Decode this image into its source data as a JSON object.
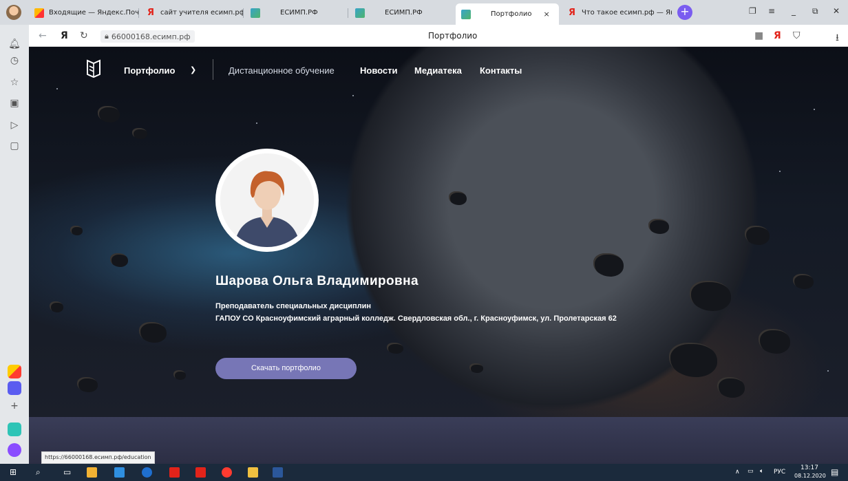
{
  "browser": {
    "tabs": [
      {
        "label": "Входящие — Яндекс.Почт",
        "icon": "mail-icon",
        "active": false
      },
      {
        "label": "сайт учителя есимп.рф —",
        "icon": "yandex-icon",
        "active": false
      },
      {
        "label": "ЕСИМП.РФ",
        "icon": "esimp-icon",
        "active": false
      },
      {
        "label": "ЕСИМП.РФ",
        "icon": "esimp-icon",
        "active": false
      },
      {
        "label": "Портфолио",
        "icon": "esimp-icon",
        "active": true
      },
      {
        "label": "Что такое есимп.рф — Ян",
        "icon": "yandex-icon",
        "active": false
      }
    ],
    "close_symbol": "×",
    "new_tab_symbol": "+",
    "address": "66000168.есимп.рф",
    "page_title": "Портфолио",
    "yandex_letter": "Я",
    "status_url": "https://66000168.есимп.рф/education"
  },
  "site": {
    "nav": {
      "portfolio": "Портфолио",
      "items": [
        "Дистанционное обучение",
        "Новости",
        "Медиатека",
        "Контакты"
      ]
    },
    "profile": {
      "name": "Шарова Ольга Владимировна",
      "position": "Преподаватель специальных дисциплин",
      "organization": "ГАПОУ СО Красноуфимский аграрный колледж. Свердловская обл., г. Красноуфимск, ул. Пролетарская 62",
      "download_label": "Скачать портфолио"
    }
  },
  "taskbar": {
    "language": "РУС",
    "time": "13:17",
    "date": "08.12.2020"
  },
  "colors": {
    "accent_button": "#7776b6",
    "tab_strip": "#d7dbe0",
    "taskbar": "#1b2a3c"
  }
}
